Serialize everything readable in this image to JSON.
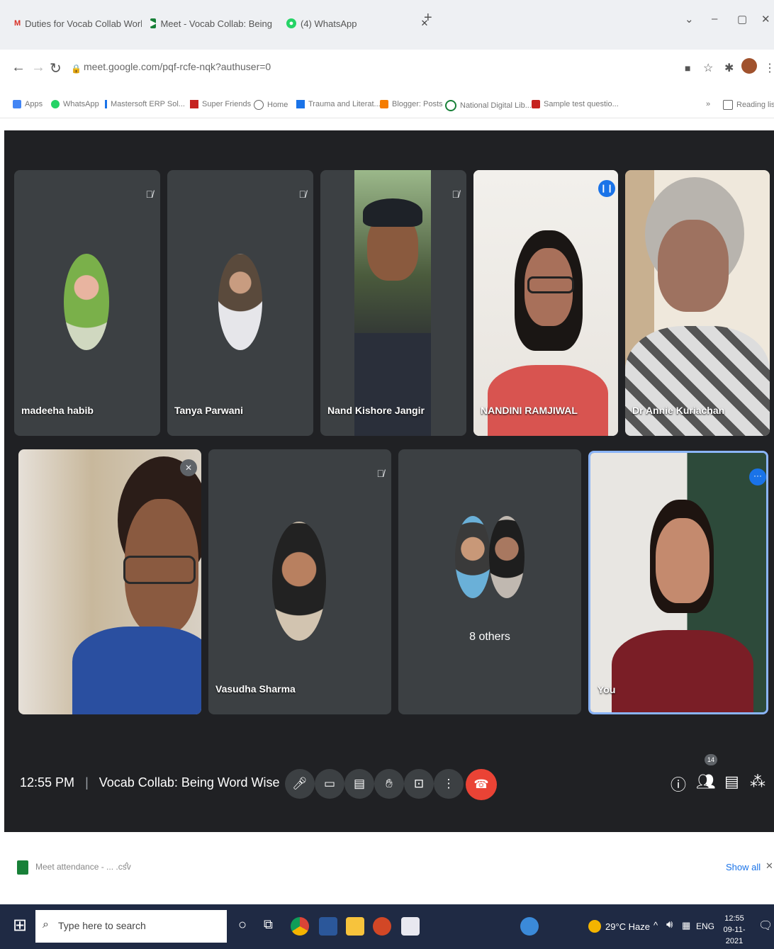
{
  "browser": {
    "tabs": [
      {
        "label": "Duties for Vocab Collab Worksh",
        "icon": "gmail-icon",
        "color": "#d93025"
      },
      {
        "label": "Meet - Vocab Collab: Being",
        "icon": "meet-icon",
        "color": "#188038"
      },
      {
        "label": "(4) WhatsApp",
        "icon": "whatsapp-icon",
        "color": "#25d366"
      }
    ],
    "url": "meet.google.com/pqf-rcfe-nqk?authuser=0",
    "bookmarks": [
      "Apps",
      "WhatsApp",
      "Mastersoft ERP Sol...",
      "Super Friends",
      "Home",
      "Trauma and Literat...",
      "Blogger: Posts",
      "National Digital Lib...",
      "Sample test questio..."
    ],
    "reading_list": "Reading list"
  },
  "meet": {
    "participants": [
      {
        "name": "madeeha habib",
        "muted": true,
        "mode": "avatar"
      },
      {
        "name": "Tanya Parwani",
        "muted": true,
        "mode": "avatar"
      },
      {
        "name": "Nand Kishore Jangir",
        "muted": true,
        "mode": "video"
      },
      {
        "name": "NANDINI RAMJIWAL",
        "muted": false,
        "mode": "video"
      },
      {
        "name": "Dr Annie Kuriachan",
        "muted": false,
        "mode": "video"
      },
      {
        "name": "",
        "muted": true,
        "mode": "video"
      },
      {
        "name": "Vasudha Sharma",
        "muted": true,
        "mode": "avatar"
      },
      {
        "name": "8 others",
        "muted": false,
        "mode": "group"
      },
      {
        "name": "You",
        "muted": false,
        "mode": "video"
      }
    ],
    "time": "12:55 PM",
    "meeting_title": "Vocab Collab: Being Word Wise",
    "participant_count": "14",
    "accent": "#8ab4f8",
    "end_call_color": "#ea4335"
  },
  "downloads": {
    "file": "Meet attendance - ... .csv",
    "show_all": "Show all"
  },
  "taskbar": {
    "search_placeholder": "Type here to search",
    "weather": "29°C Haze",
    "lang": "ENG",
    "clock_time": "12:55",
    "clock_date": "09-11-2021"
  }
}
